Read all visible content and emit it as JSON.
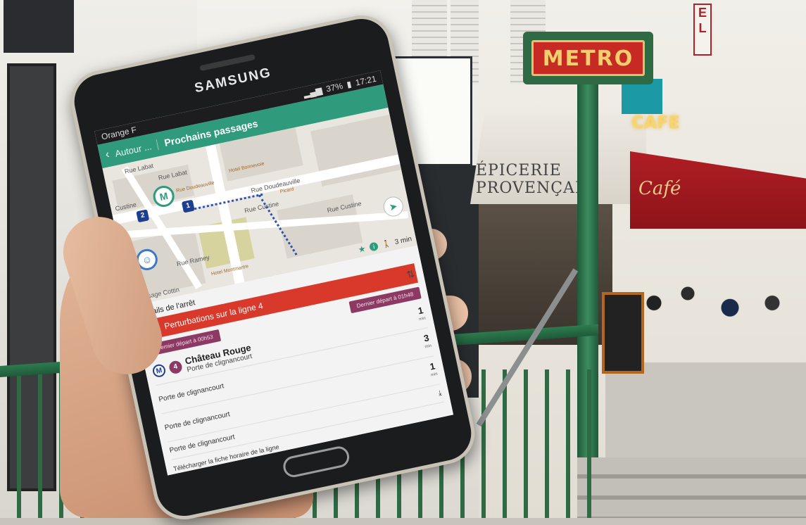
{
  "scene": {
    "metro_sign": "METRO",
    "cafe_neon": "CAFE",
    "shop_sign": "ell",
    "epicerie_awning": "ÉPICERIE PROVENÇALE",
    "red_awning": "Café"
  },
  "phone": {
    "brand": "SAMSUNG",
    "status": {
      "carrier": "Orange F",
      "battery": "37%",
      "time": "17:21"
    },
    "appbar": {
      "back_crumb": "Autour ...",
      "title": "Prochains passages"
    },
    "map": {
      "streets": [
        "Rue Labat",
        "Rue Labat",
        "Custine",
        "Rue Doudeauville",
        "Rue Custine",
        "Rue Custine",
        "Rue Ramey",
        "Passage Cottin"
      ],
      "pois": [
        "Rue Doudeauville",
        "Hotel Bonnevoie",
        "Picard",
        "Hotel Montmartre"
      ],
      "stop_numbers": [
        "2",
        "1"
      ],
      "metro_pin": "M",
      "walk_time": "3 min",
      "info_icon_label": "i"
    },
    "details": {
      "title": "Détails de l'arrêt",
      "disruption": "Perturbations sur la ligne 4",
      "first_departure": "Premier départ à 00h53",
      "last_departure": "Dernier départ à 01h48",
      "line_mode": "M",
      "line_number": "4",
      "stop_name": "Château Rouge",
      "direction": "Porte de clignancourt",
      "departures": [
        {
          "destination": "",
          "minutes": "1",
          "unit": "min"
        },
        {
          "destination": "Porte de clignancourt",
          "minutes": "3",
          "unit": "min"
        },
        {
          "destination": "Porte de clignancourt",
          "minutes": "1",
          "unit": "min"
        },
        {
          "destination": "Porte de clignancourt",
          "minutes": "",
          "unit": ""
        }
      ],
      "download": "Télécharger la fiche horaire de la ligne"
    }
  }
}
